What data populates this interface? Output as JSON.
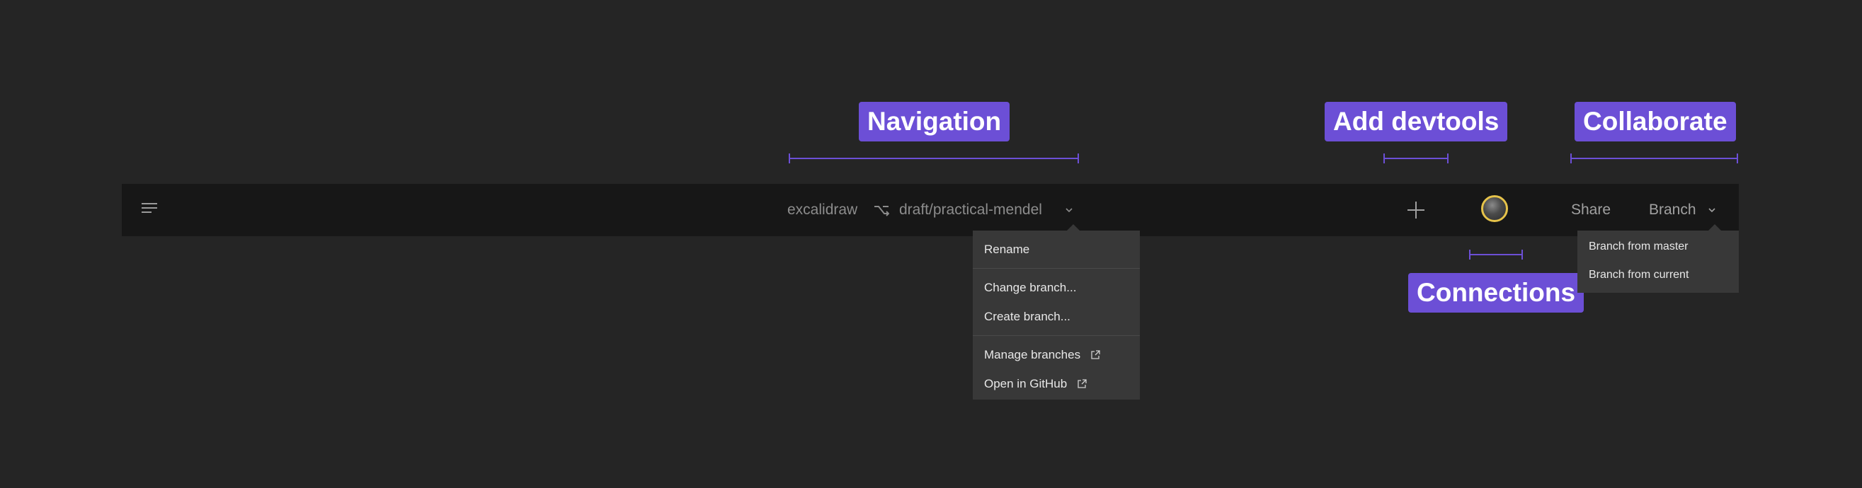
{
  "callouts": {
    "navigation": "Navigation",
    "add_devtools": "Add devtools",
    "collaborate": "Collaborate",
    "connections": "Connections"
  },
  "toolbar": {
    "menu_icon": "hamburger-icon",
    "repo": "excalidraw",
    "branch_icon": "git-branch-icon",
    "branch": "draft/practical-mendel",
    "add_icon": "plus-icon",
    "share_label": "Share",
    "branch_label": "Branch"
  },
  "nav_menu": {
    "items": [
      "Rename",
      "Change branch...",
      "Create branch...",
      "Manage branches",
      "Open in GitHub"
    ]
  },
  "branch_menu": {
    "items": [
      "Branch from master",
      "Branch from current"
    ]
  },
  "colors": {
    "accent": "#6c4fd6",
    "background": "#252525",
    "toolbar": "#171717",
    "menu": "#383838",
    "avatar_ring": "#e6c34a"
  }
}
